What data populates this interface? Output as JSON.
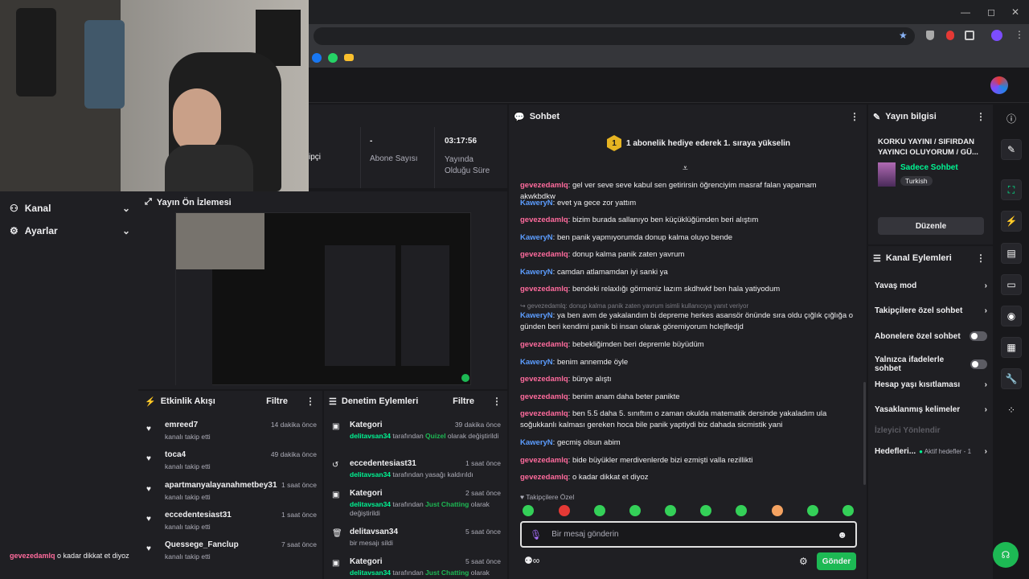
{
  "browser": {
    "window_controls": [
      "—",
      "◻",
      "✕"
    ],
    "bookmark_icons": [
      "facebook-icon",
      "whatsapp-icon",
      "folder-icon"
    ]
  },
  "overlay": {
    "chat_user": "gevezedamlq",
    "chat_text": "o kadar dikkat et diyoz"
  },
  "leftnav": {
    "items": [
      {
        "label": "Kanal",
        "icon": "people-icon"
      },
      {
        "label": "Ayarlar",
        "icon": "gear-icon"
      }
    ]
  },
  "stats": {
    "items": [
      {
        "value": "",
        "label": "ipçi"
      },
      {
        "value": "-",
        "label": "Abone Sayısı"
      },
      {
        "value": "03:17:56",
        "label": "Yayında Olduğu Süre"
      }
    ]
  },
  "preview": {
    "title": "Yayın Ön İzlemesi"
  },
  "activity": {
    "title": "Etkinlik Akışı",
    "filter": "Filtre",
    "items": [
      {
        "name": "emreed7",
        "time": "14 dakika önce",
        "action": "kanalı takip etti"
      },
      {
        "name": "toca4",
        "time": "49 dakika önce",
        "action": "kanalı takip etti"
      },
      {
        "name": "apartmanyalayanahmetbey31",
        "time": "1 saat önce",
        "action": "kanalı takip etti"
      },
      {
        "name": "eccedentesiast31",
        "time": "1 saat önce",
        "action": "kanalı takip etti"
      },
      {
        "name": "Quessege_Fanclup",
        "time": "7 saat önce",
        "action": "kanalı takip etti"
      }
    ]
  },
  "modactions": {
    "title": "Denetim Eylemleri",
    "filter": "Filtre",
    "items": [
      {
        "name": "Kategori",
        "time": "39 dakika önce",
        "actor": "delitavsan34",
        "mid": " tarafından ",
        "target": "Quizel",
        "tail": " olarak değiştirildi"
      },
      {
        "name": "eccedentesiast31",
        "time": "1 saat önce",
        "actor": "delitavsan34",
        "mid": " tarafından yasağı kaldırıldı",
        "target": "",
        "tail": ""
      },
      {
        "name": "Kategori",
        "time": "2 saat önce",
        "actor": "delitavsan34",
        "mid": " tarafından ",
        "target": "Just Chatting",
        "tail": " olarak değiştirildi"
      },
      {
        "name": "delitavsan34",
        "time": "5 saat önce",
        "actor": "",
        "mid": "bir mesajı sildi",
        "target": "",
        "tail": ""
      },
      {
        "name": "Kategori",
        "time": "5 saat önce",
        "actor": "delitavsan34",
        "mid": " tarafından ",
        "target": "Just Chatting",
        "tail": " olarak"
      }
    ]
  },
  "chat": {
    "title": "Sohbet",
    "banner_rank": "1",
    "banner": "1 abonelik hediye ederek 1. sıraya yükselin",
    "messages": [
      {
        "user": "gevezedamlq",
        "text": " gel ver seve seve kabul sen getirirsin öğrenciyim masraf falan yapamam akwkbdkw"
      },
      {
        "user": "KaweryN",
        "text": " evet ya gece zor yattım"
      },
      {
        "user": "gevezedamlq",
        "text": " bizim burada sallanıyo ben küçüklüğümden beri alıştım"
      },
      {
        "user": "KaweryN",
        "text": " ben panik yapmıyorumda donup kalma oluyo bende"
      },
      {
        "user": "gevezedamlq",
        "text": " donup kalma panik zaten yavrum"
      },
      {
        "user": "KaweryN",
        "text": " camdan atlamamdan iyi sanki ya"
      },
      {
        "user": "gevezedamlq",
        "text": " bendeki relaxlığı görmeniz lazım skdhwkf ben hala yatiyodum"
      }
    ],
    "reply_note": "↪ gevezedamlq: donup kalma panik zaten yavrum isimli kullanıcıya yanıt veriyor",
    "messages2": [
      {
        "user": "KaweryN",
        "text": " ya ben avm de yakalandım bi depreme herkes asansör önünde sıra oldu çığlık çığlığa o günden beri kendimi panik bi insan olarak göremiyorum hclejfledjd"
      },
      {
        "user": "gevezedamlq",
        "text": " bebekliğimden beri depremle büyüdüm"
      },
      {
        "user": "KaweryN",
        "text": " benim annemde öyle"
      },
      {
        "user": "gevezedamlq",
        "text": " bünye alıştı"
      },
      {
        "user": "gevezedamlq",
        "text": " benim anam daha beter panikte"
      },
      {
        "user": "gevezedamlq",
        "text": " ben 5.5 daha 5. sınıftım o zaman okulda matematik dersinde yakaladım ula soğukkanlı kalması gereken hoca bile panik yaptiydi biz dahada sicmistik yani"
      },
      {
        "user": "KaweryN",
        "text": " gecmiş olsun abim"
      },
      {
        "user": "gevezedamlq",
        "text": " bide büyükler merdivenlerde bizi ezmişti valla rezillikti"
      },
      {
        "user": "gevezedamlq",
        "text": " o kadar dikkat et diyoz"
      }
    ],
    "followers_only": "Takipçilere Özel",
    "input_placeholder": "Bir mesaj gönderin",
    "send_label": "Gönder"
  },
  "streaminfo": {
    "title": "Yayın bilgisi",
    "stream_title": "KORKU YAYINI / SIFIRDAN YAYINCI OLUYORUM / GÜ...",
    "category": "Sadece Sohbet",
    "tag": "Turkish",
    "edit_label": "Düzenle"
  },
  "channelactions": {
    "title": "Kanal Eylemleri",
    "items": [
      {
        "label": "Yavaş mod",
        "control": "chevron"
      },
      {
        "label": "Takipçilere özel sohbet",
        "control": "chevron"
      },
      {
        "label": "Abonelere özel sohbet",
        "control": "toggle"
      },
      {
        "label": "Yalnızca ifadelerle sohbet",
        "control": "toggle"
      },
      {
        "label": "Hesap yaşı kısıtlaması",
        "control": "chevron"
      },
      {
        "label": "Yasaklanmış kelimeler",
        "control": "chevron"
      }
    ],
    "disabled_item": "İzleyici Yönlendir",
    "goals_label": "Hedefleri...",
    "goals_value": "Aktif hedefler - 1"
  },
  "colors": {
    "accent_green": "#00f593",
    "send_green": "#1db954",
    "user_pink": "#ff6b9d",
    "user_blue": "#5c9dff"
  }
}
